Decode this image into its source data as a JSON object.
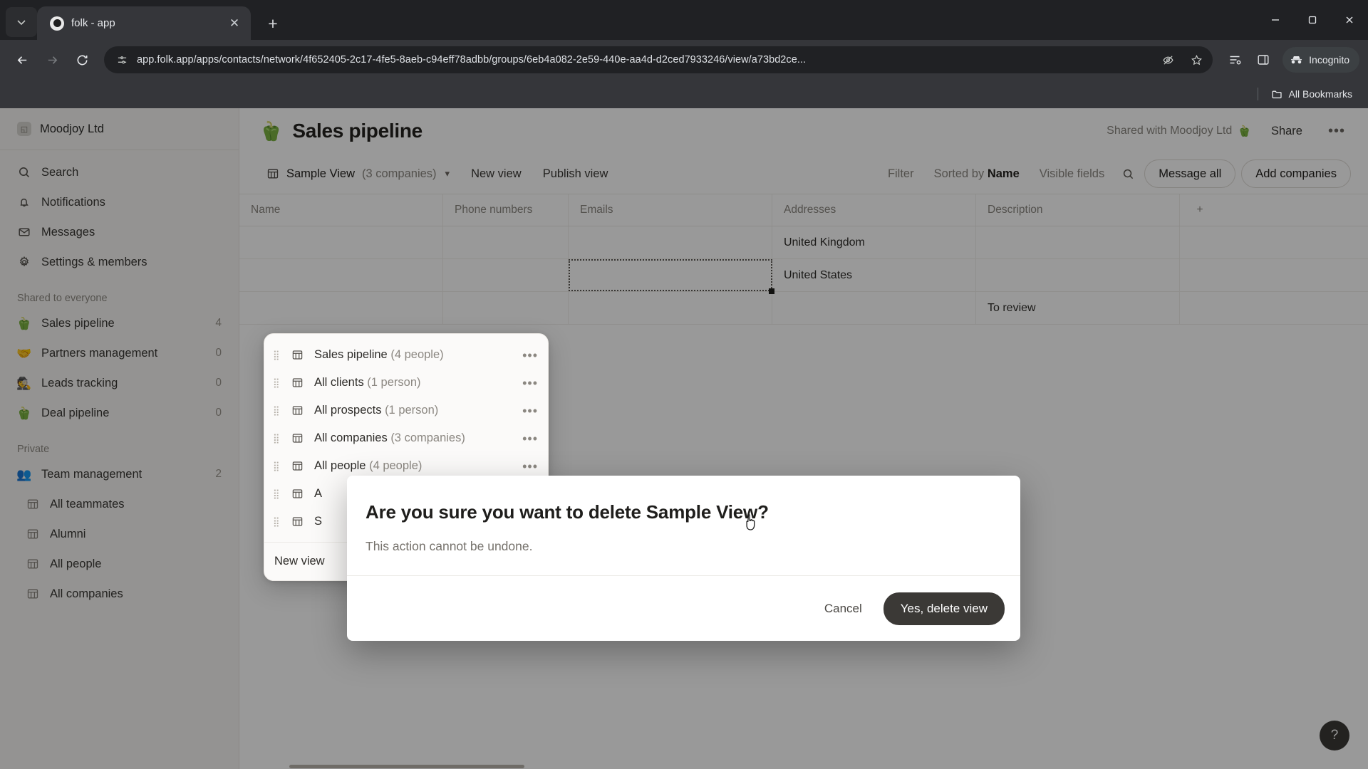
{
  "browser": {
    "tab": {
      "title": "folk - app",
      "favicon_icon": "folk-logo-icon",
      "close_icon": "close-icon"
    },
    "tab_search_icon": "tab-search-chevron-icon",
    "new_tab_label": "+",
    "window": {
      "minimize": "minimize-icon",
      "maximize": "maximize-icon",
      "close": "close-icon"
    },
    "nav": {
      "back_icon": "back-arrow-icon",
      "forward_icon": "forward-arrow-icon",
      "reload_icon": "reload-icon"
    },
    "omnibox": {
      "site_icon": "page-settings-icon",
      "url": "app.folk.app/apps/contacts/network/4f652405-2c17-4fe5-8aeb-c94eff78adbb/groups/6eb4a082-2e59-440e-aa4d-d2ced7933246/view/a73bd2ce...",
      "hide_icon": "eye-slash-icon",
      "bookmark_icon": "star-icon"
    },
    "actions": {
      "reading_list_icon": "reading-list-icon",
      "side_panel_icon": "side-panel-icon"
    },
    "incognito": {
      "label": "Incognito",
      "icon": "incognito-icon"
    },
    "bookmarks": {
      "all_label": "All Bookmarks",
      "folder_icon": "folder-icon"
    }
  },
  "sidebar": {
    "workspace": {
      "name": "Moodjoy Ltd",
      "logo_icon": "workspace-logo-icon"
    },
    "nav": [
      {
        "label": "Search",
        "icon": "search-icon"
      },
      {
        "label": "Notifications",
        "icon": "bell-icon"
      },
      {
        "label": "Messages",
        "icon": "mail-icon"
      },
      {
        "label": "Settings & members",
        "icon": "gear-icon"
      }
    ],
    "shared_group_label": "Shared to everyone",
    "shared_items": [
      {
        "label": "Sales pipeline",
        "emoji": "🫑",
        "count": "4"
      },
      {
        "label": "Partners management",
        "emoji": "🤝",
        "count": "0"
      },
      {
        "label": "Leads tracking",
        "emoji": "🕵",
        "count": "0"
      },
      {
        "label": "Deal pipeline",
        "emoji": "🫑",
        "count": "0"
      }
    ],
    "private_group_label": "Private",
    "private_items": [
      {
        "label": "Team management",
        "emoji": "👥",
        "count": "2"
      }
    ],
    "private_subitems": [
      {
        "label": "All teammates",
        "icon": "table-icon"
      },
      {
        "label": "Alumni",
        "icon": "table-icon"
      },
      {
        "label": "All people",
        "icon": "table-icon"
      },
      {
        "label": "All companies",
        "icon": "table-icon"
      }
    ]
  },
  "header": {
    "emoji": "🫑",
    "title": "Sales pipeline",
    "shared_label": "Shared with Moodjoy Ltd",
    "shared_emoji": "🫑",
    "share_label": "Share",
    "more_label": "•••"
  },
  "toolbar": {
    "view_icon": "table-icon",
    "view_name": "Sample View",
    "view_count": "(3 companies)",
    "chevron_icon": "chevron-down-icon",
    "new_view_label": "New view",
    "publish_view_label": "Publish view",
    "filter_label": "Filter",
    "sorted_prefix": "Sorted by ",
    "sorted_field": "Name",
    "visible_fields_label": "Visible fields",
    "search_icon": "search-icon",
    "message_all_label": "Message all",
    "add_companies_label": "Add companies"
  },
  "table": {
    "columns": [
      "Name",
      "Phone numbers",
      "Emails",
      "Addresses",
      "Description"
    ],
    "add_column_label": "+",
    "rows": [
      {
        "name": "",
        "phone": "",
        "email": "",
        "address": "United Kingdom",
        "description": ""
      },
      {
        "name": "",
        "phone": "",
        "email": "",
        "address": "United States",
        "description": ""
      },
      {
        "name": "",
        "phone": "",
        "email": "",
        "address": "",
        "description": "To review"
      }
    ]
  },
  "view_menu": {
    "items": [
      {
        "label": "Sales pipeline",
        "count": "(4 people)",
        "icon": "table-icon",
        "grip": "drag-handle-icon",
        "menu": "•••"
      },
      {
        "label": "All clients",
        "count": "(1 person)",
        "icon": "table-icon",
        "grip": "drag-handle-icon",
        "menu": "•••"
      },
      {
        "label": "All prospects",
        "count": "(1 person)",
        "icon": "table-icon",
        "grip": "drag-handle-icon",
        "menu": "•••"
      },
      {
        "label": "All companies",
        "count": "(3 companies)",
        "icon": "table-icon",
        "grip": "drag-handle-icon",
        "menu": "•••"
      },
      {
        "label": "All people",
        "count": "(4 people)",
        "icon": "table-icon",
        "grip": "drag-handle-icon",
        "menu": "•••"
      },
      {
        "label": "A",
        "count": "",
        "icon": "table-icon",
        "grip": "drag-handle-icon",
        "menu": "•••"
      },
      {
        "label": "S",
        "count": "",
        "icon": "table-icon",
        "grip": "drag-handle-icon",
        "menu": "•••"
      }
    ],
    "footer_label": "New view"
  },
  "modal": {
    "title": "Are you sure you want to delete Sample View?",
    "subtitle": "This action cannot be undone.",
    "cancel_label": "Cancel",
    "confirm_label": "Yes, delete view"
  },
  "help": {
    "label": "?"
  },
  "colors": {
    "chrome_bg": "#35363a",
    "chrome_dark": "#202124",
    "sidebar_bg": "#f7f6f4",
    "danger_btn": "#3b3936",
    "text_primary": "#24221f",
    "text_muted": "#8b8781"
  }
}
